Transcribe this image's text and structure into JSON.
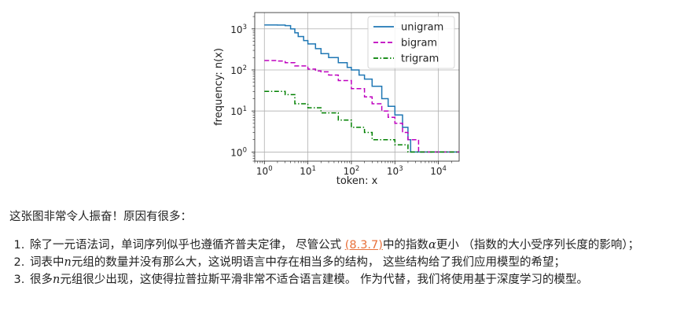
{
  "chart_data": {
    "type": "line",
    "xlabel": "token: x",
    "ylabel": "frequency: n(x)",
    "xscale": "log",
    "yscale": "log",
    "xlim": [
      0.6,
      30000
    ],
    "ylim": [
      0.6,
      2500
    ],
    "x_ticks": [
      1,
      10,
      100,
      1000,
      10000
    ],
    "y_ticks": [
      1,
      10,
      100,
      1000
    ],
    "grid": true,
    "legend_position": "top-right",
    "series": [
      {
        "name": "unigram",
        "color": "#1f77b4",
        "style": "solid",
        "x": [
          1,
          2,
          3,
          4,
          5,
          6,
          8,
          10,
          15,
          20,
          30,
          50,
          80,
          100,
          150,
          200,
          300,
          500,
          700,
          1000,
          1500,
          2000,
          2300,
          2500,
          3000,
          4000,
          30000
        ],
        "y": [
          1250,
          1240,
          1200,
          1000,
          800,
          650,
          520,
          430,
          330,
          250,
          200,
          150,
          115,
          100,
          75,
          60,
          40,
          20,
          13,
          8,
          4,
          2,
          1,
          1,
          1,
          1,
          1
        ]
      },
      {
        "name": "bigram",
        "color": "#bf00bf",
        "style": "dashed",
        "x": [
          1,
          2,
          3,
          5,
          10,
          15,
          20,
          30,
          50,
          100,
          200,
          300,
          500,
          700,
          1000,
          1500,
          2000,
          3000,
          3500,
          5000,
          30000
        ],
        "y": [
          170,
          165,
          150,
          125,
          105,
          95,
          90,
          75,
          55,
          35,
          22,
          15,
          10,
          7,
          5,
          3,
          2,
          2,
          1,
          1,
          1
        ]
      },
      {
        "name": "trigram",
        "color": "#008000",
        "style": "dash-dot",
        "x": [
          1,
          2,
          3,
          5,
          10,
          20,
          50,
          100,
          200,
          300,
          500,
          1000,
          2000,
          3000,
          5000,
          10000,
          30000
        ],
        "y": [
          30,
          30,
          25,
          15,
          12,
          9,
          6,
          4,
          3,
          2,
          2,
          1.5,
          1,
          1,
          1,
          1,
          1
        ]
      }
    ]
  },
  "intro_text": "这张图非常令人振奋！原因有很多：",
  "points": {
    "p1_before": "除了一元语法词，单词序列似乎也遵循齐普夫定律， 尽管公式 ",
    "p1_link": "(8.3.7)",
    "p1_mid": "中的指数",
    "p1_alpha": "α",
    "p1_after": "更小 （指数的大小受序列长度的影响）；",
    "p2_before": "词表中",
    "p2_n": "n",
    "p2_after": "元组的数量并没有那么大，这说明语言中存在相当多的结构， 这些结构给了我们应用模型的希望；",
    "p3_before": "很多",
    "p3_n": "n",
    "p3_after": "元组很少出现，这使得拉普拉斯平滑非常不适合语言建模。 作为代替，我们将使用基于深度学习的模型。"
  }
}
